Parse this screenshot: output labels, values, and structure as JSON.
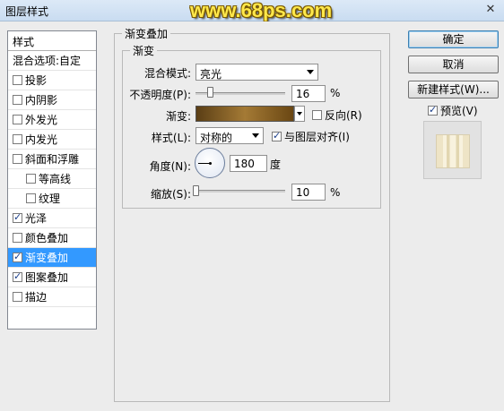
{
  "window": {
    "title": "图层样式",
    "watermark": "www.68ps.com",
    "close_glyph": "✕"
  },
  "sidebar": {
    "header": "样式",
    "blend_options": "混合选项:自定",
    "items": [
      {
        "label": "投影",
        "checked": false,
        "sub": false,
        "active": false
      },
      {
        "label": "内阴影",
        "checked": false,
        "sub": false,
        "active": false
      },
      {
        "label": "外发光",
        "checked": false,
        "sub": false,
        "active": false
      },
      {
        "label": "内发光",
        "checked": false,
        "sub": false,
        "active": false
      },
      {
        "label": "斜面和浮雕",
        "checked": false,
        "sub": false,
        "active": false
      },
      {
        "label": "等高线",
        "checked": false,
        "sub": true,
        "active": false
      },
      {
        "label": "纹理",
        "checked": false,
        "sub": true,
        "active": false
      },
      {
        "label": "光泽",
        "checked": true,
        "sub": false,
        "active": false
      },
      {
        "label": "颜色叠加",
        "checked": false,
        "sub": false,
        "active": false
      },
      {
        "label": "渐变叠加",
        "checked": true,
        "sub": false,
        "active": true
      },
      {
        "label": "图案叠加",
        "checked": true,
        "sub": false,
        "active": false
      },
      {
        "label": "描边",
        "checked": false,
        "sub": false,
        "active": false
      }
    ]
  },
  "gradient_overlay": {
    "section_title": "渐变叠加",
    "subsection_title": "渐变",
    "blend_mode_label": "混合模式:",
    "blend_mode_value": "亮光",
    "opacity_label": "不透明度(P):",
    "opacity_value": "16",
    "opacity_percent": 16,
    "gradient_label": "渐变:",
    "reverse_label": "反向(R)",
    "reverse_checked": false,
    "style_label": "样式(L):",
    "style_value": "对称的",
    "align_label": "与图层对齐(I)",
    "align_checked": true,
    "angle_label": "角度(N):",
    "angle_value": "180",
    "angle_unit": "度",
    "scale_label": "缩放(S):",
    "scale_value": "10",
    "scale_percent": 10,
    "percent_unit": "%"
  },
  "buttons": {
    "ok": "确定",
    "cancel": "取消",
    "new_style": "新建样式(W)...",
    "preview_label": "预览(V)",
    "preview_checked": true
  },
  "colors": {
    "active_item": "#3399ff",
    "gradient_dark": "#5a3e15",
    "gradient_light": "#a47a35"
  }
}
